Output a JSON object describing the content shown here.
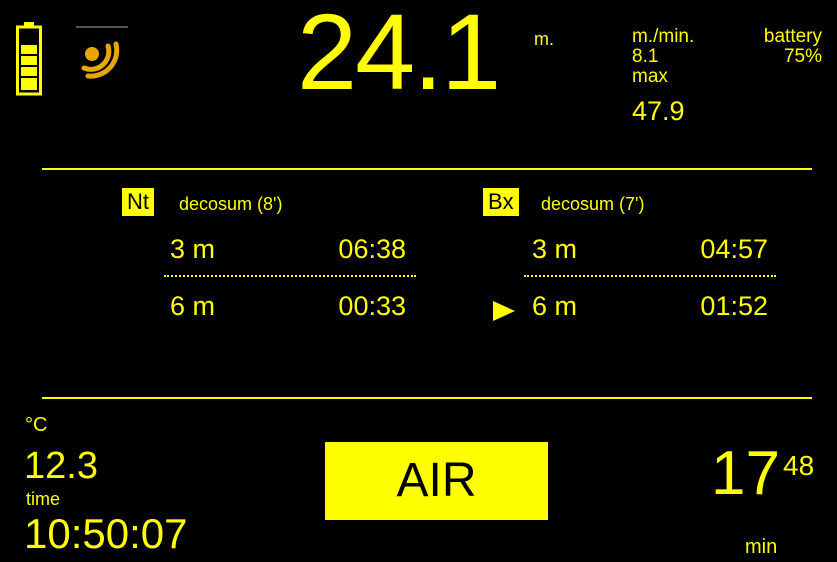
{
  "status_bar": {
    "battery_icon": "battery-icon",
    "signal_icon": "transmitter-signal-icon"
  },
  "depth": {
    "value": "24.1",
    "unit": "m."
  },
  "ascent_rate": {
    "label": "m./min.",
    "value": "8.1"
  },
  "max_depth": {
    "label": "max",
    "value": "47.9"
  },
  "battery": {
    "label": "battery",
    "value": "75%"
  },
  "deco_panels": {
    "nt": {
      "tag": "Nt",
      "title": "decosum (8')",
      "stops": [
        {
          "depth": "3 m",
          "time": "06:38"
        },
        {
          "depth": "6 m",
          "time": "00:33"
        }
      ]
    },
    "bx": {
      "tag": "Bx",
      "title": "decosum (7')",
      "stops": [
        {
          "depth": "3 m",
          "time": "04:57"
        },
        {
          "depth": "6 m",
          "time": "01:52"
        }
      ]
    }
  },
  "temperature": {
    "unit": "°C",
    "value": "12.3"
  },
  "clock": {
    "label": "time",
    "value": "10:50:07"
  },
  "gas": {
    "label": "AIR"
  },
  "dive_time": {
    "minutes": "17",
    "seconds": "48",
    "unit": "min"
  },
  "colors": {
    "background": "#000000",
    "foreground": "#FFFF00",
    "icon_accent": "#E6A800"
  }
}
